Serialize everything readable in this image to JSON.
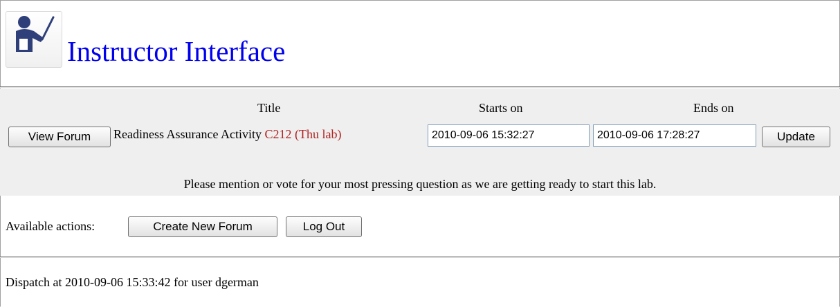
{
  "header": {
    "logo_icon": "instructor-pointer-icon",
    "title": "Instructor Interface"
  },
  "forum_table": {
    "columns": {
      "title": "Title",
      "starts_on": "Starts on",
      "ends_on": "Ends on"
    },
    "row": {
      "view_button_label": "View Forum",
      "title_text": "Readiness Assurance Activity",
      "course_text": "C212 (Thu lab)",
      "starts_on": "2010-09-06 15:32:27",
      "ends_on": "2010-09-06 17:28:27",
      "update_button_label": "Update",
      "description": "Please mention or vote for your most pressing question as we are getting ready to start this lab."
    }
  },
  "actions": {
    "label": "Available actions:",
    "create_button_label": "Create New Forum",
    "logout_button_label": "Log Out"
  },
  "status": {
    "text": "Dispatch at 2010-09-06 15:33:42 for user dgerman"
  },
  "colors": {
    "title_link": "#0000ee",
    "course_highlight": "#b22222",
    "band_background": "#efefef"
  }
}
